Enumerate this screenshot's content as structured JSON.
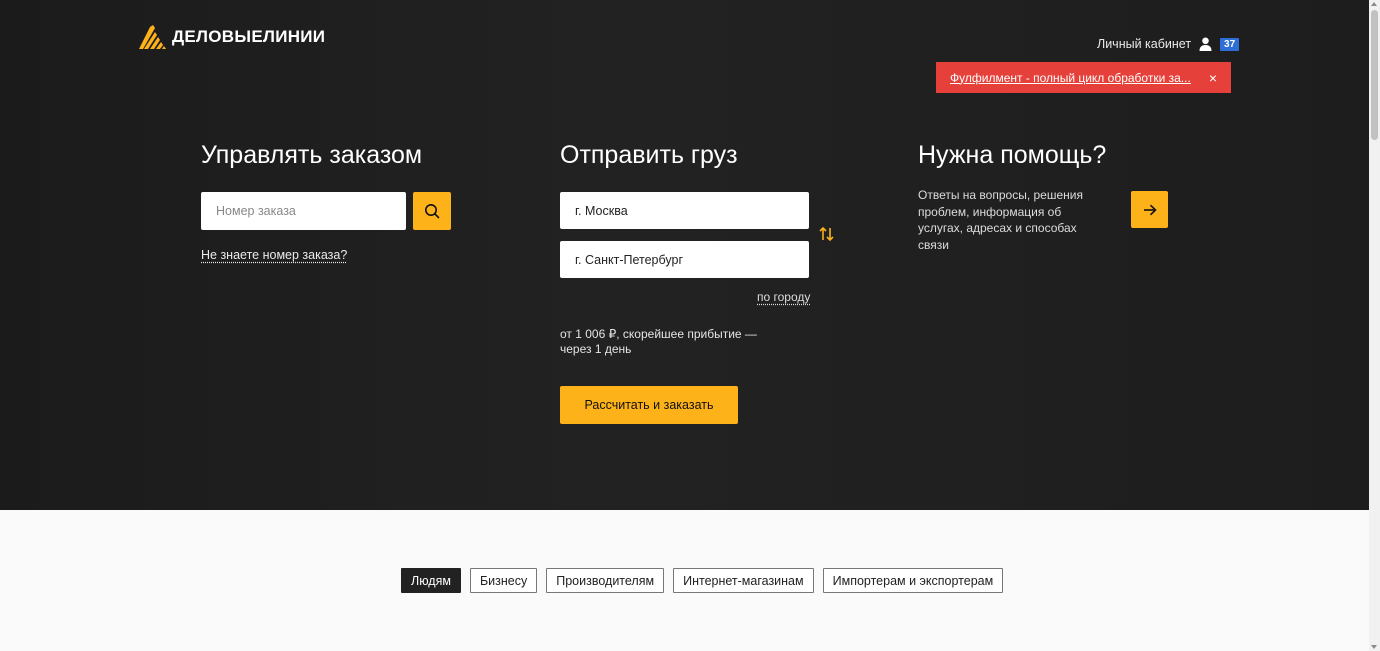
{
  "header": {
    "logo_text": "ДЕЛОВЫЕЛИНИИ",
    "account_label": "Личный кабинет",
    "notifications_count": "37"
  },
  "promo": {
    "text": "Фулфилмент - полный цикл обработки за...",
    "close": "×"
  },
  "order": {
    "title": "Управлять заказом",
    "input_placeholder": "Номер заказа",
    "unknown_link": "Не знаете номер заказа?"
  },
  "ship": {
    "title": "Отправить груз",
    "from_value": "г. Москва",
    "to_value": "г. Санкт-Петербург",
    "by_city": "по городу",
    "price_info": "от 1 006 ₽, скорейшее прибытие — через 1 день",
    "calc_button": "Рассчитать и заказать"
  },
  "help": {
    "title": "Нужна помощь?",
    "text": "Ответы на вопросы, решения проблем, информация об услугах, адресах и способах связи"
  },
  "audience_tabs": [
    {
      "label": "Людям",
      "active": true
    },
    {
      "label": "Бизнесу",
      "active": false
    },
    {
      "label": "Производителям",
      "active": false
    },
    {
      "label": "Интернет-магазинам",
      "active": false
    },
    {
      "label": "Импортерам и экспортерам",
      "active": false
    }
  ],
  "colors": {
    "accent": "#fdb219",
    "promo_bg": "#e6403a",
    "hero_bg": "#1e1e1e",
    "badge": "#2d6fd6"
  }
}
